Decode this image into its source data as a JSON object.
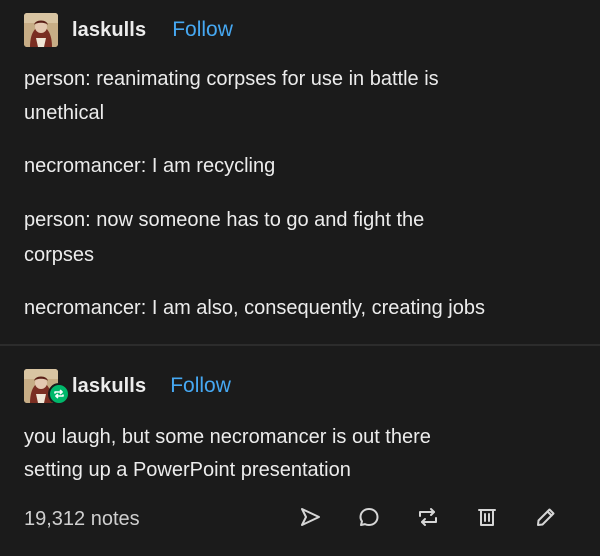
{
  "posts": [
    {
      "username": "laskulls",
      "follow_label": "Follow",
      "lines": [
        "person: reanimating corpses for use in battle is",
        "unethical",
        "necromancer: I am recycling",
        "person: now someone has to go and fight the",
        "corpses",
        "necromancer: I am also, consequently, creating jobs"
      ]
    },
    {
      "username": "laskulls",
      "follow_label": "Follow",
      "lines": [
        "you laugh, but some necromancer is out there",
        "setting up a PowerPoint presentation"
      ]
    }
  ],
  "footer": {
    "notes": "19,312 notes",
    "actions": [
      {
        "icon": "send-icon"
      },
      {
        "icon": "reply-icon"
      },
      {
        "icon": "reblog-icon"
      },
      {
        "icon": "delete-icon"
      },
      {
        "icon": "edit-icon"
      }
    ]
  },
  "colors": {
    "background": "#1b1b1b",
    "text": "#ececec",
    "follow": "#46a8f2",
    "reblog_badge": "#00b86b"
  }
}
